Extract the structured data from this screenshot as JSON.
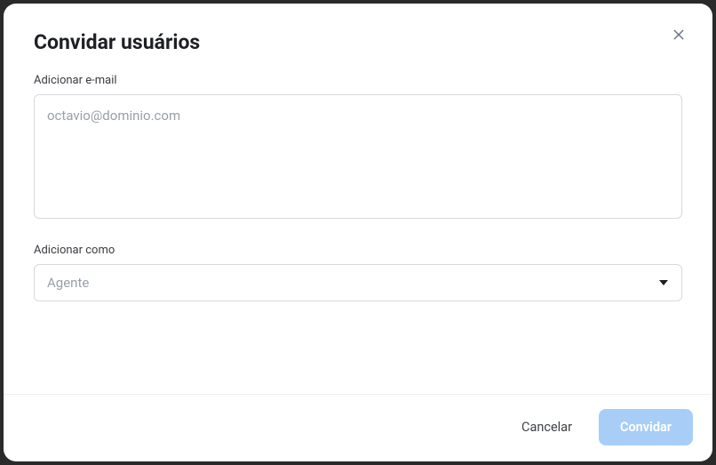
{
  "modal": {
    "title": "Convidar usuários",
    "close_label": "Fechar"
  },
  "email_field": {
    "label": "Adicionar e-mail",
    "placeholder": "octavio@dominio.com",
    "value": ""
  },
  "role_field": {
    "label": "Adicionar como",
    "selected": "Agente"
  },
  "footer": {
    "cancel_label": "Cancelar",
    "invite_label": "Convidar"
  }
}
